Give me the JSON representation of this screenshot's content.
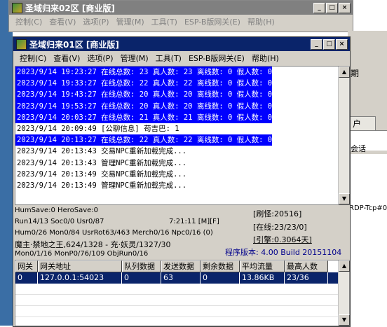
{
  "back_window": {
    "title": "圣域归来02区 [商业版]",
    "menu": [
      "控制(C)",
      "查看(V)",
      "选项(P)",
      "管理(M)",
      "工具(T)",
      "ESP-B版网关(E)",
      "帮助(H)"
    ]
  },
  "window": {
    "title": "圣域归来01区 [商业版]",
    "menu": [
      "控制(C)",
      "查看(V)",
      "选项(P)",
      "管理(M)",
      "工具(T)",
      "ESP-B版网关(E)",
      "帮助(H)"
    ]
  },
  "log": [
    {
      "text": "2023/9/14 19:23:27 在线总数: 23 真人数: 23 离线数: 0 假人数: 0",
      "highlight": true
    },
    {
      "text": "2023/9/14 19:33:27 在线总数: 22 真人数: 22 离线数: 0 假人数: 0",
      "highlight": true
    },
    {
      "text": "2023/9/14 19:43:27 在线总数: 20 真人数: 20 离线数: 0 假人数: 0",
      "highlight": true
    },
    {
      "text": "2023/9/14 19:53:27 在线总数: 20 真人数: 20 离线数: 0 假人数: 0",
      "highlight": true
    },
    {
      "text": "2023/9/14 20:03:27 在线总数: 21 真人数: 21 离线数: 0 假人数: 0",
      "highlight": true
    },
    {
      "text": "2023/9/14 20:09:49 [公聊信息] 苟吉巴: 1",
      "highlight": false
    },
    {
      "text": "2023/9/14 20:13:27 在线总数: 22 真人数: 22 离线数: 0 假人数: 0",
      "highlight": true
    },
    {
      "text": "2023/9/14 20:13:43 交易NPC重新加载完成...",
      "highlight": false
    },
    {
      "text": "2023/9/14 20:13:43 管理NPC重新加载完成...",
      "highlight": false
    },
    {
      "text": "2023/9/14 20:13:49 交易NPC重新加载完成...",
      "highlight": false
    },
    {
      "text": "2023/9/14 20:13:49 管理NPC重新加载完成...",
      "highlight": false
    }
  ],
  "status": {
    "line1": "HumSave:0 HeroSave:0",
    "line2a": "Run14/13 Soc0/0 Usr0/87",
    "line2b": "7:21:11 [M][F]",
    "line3": "Hum0/26 Mon0/84 UsrRot63/463 Merch0/16 Npc0/16 (0)",
    "line4": "魔主·禁地之王,624/1328 - 充·妖灵/1327/30",
    "line5": "Mon0/1/16 MonP0/76/109 ObjRun0/16",
    "refresh": "[刷怪:20516]",
    "online": "[在线:23/23/0]",
    "engine": "[引擎:0.3064天]",
    "version": "程序版本: 4.00 Build 20151104"
  },
  "gateway_table": {
    "headers": [
      "网关",
      "网关地址",
      "队列数据",
      "发送数据",
      "剩余数据",
      "平均流量",
      "最高人数"
    ],
    "rows": [
      [
        "0",
        "127.0.0.1:54023",
        "0",
        "63",
        "0",
        "13.86KB",
        "23/36"
      ]
    ]
  },
  "right_panel": {
    "label_qi": "期",
    "label_hu": "户",
    "label_huihua": "会话",
    "label_rdp": "RDP-Tcp#0"
  },
  "colors": {
    "highlight": "#0000ff",
    "title_active": "#0a246a",
    "version_text": "#00008b"
  }
}
